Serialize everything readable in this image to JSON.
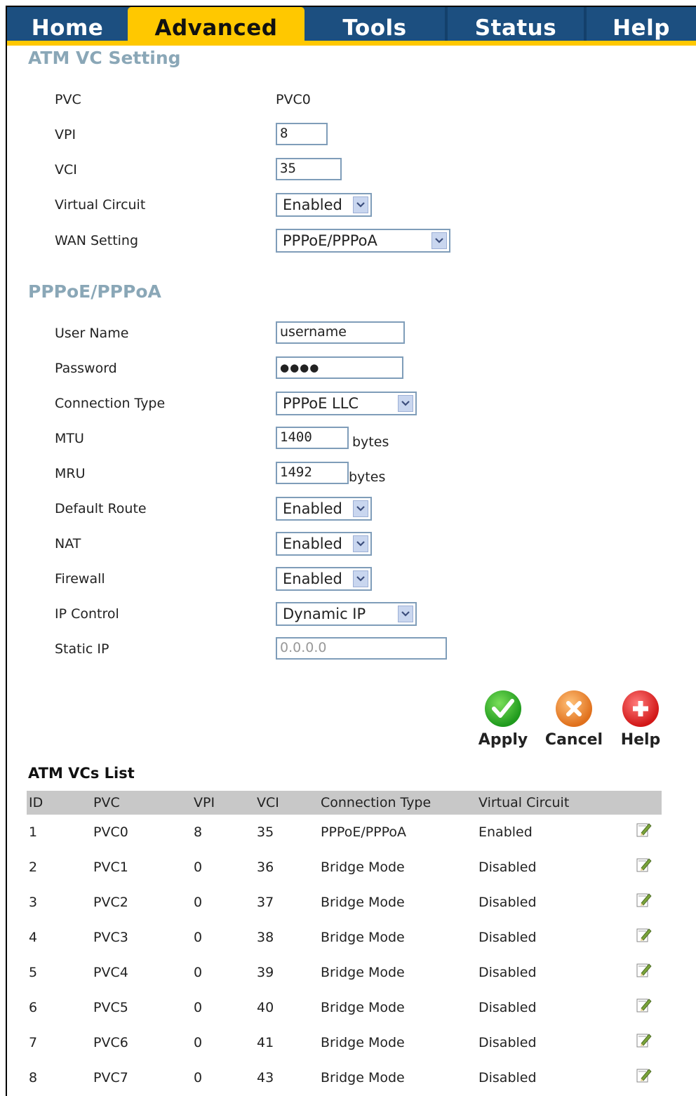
{
  "nav": {
    "tabs": [
      {
        "label": "Home"
      },
      {
        "label": "Advanced"
      },
      {
        "label": "Tools"
      },
      {
        "label": "Status"
      },
      {
        "label": "Help"
      }
    ],
    "active_tab": "Advanced"
  },
  "atm": {
    "title": "ATM VC Setting",
    "pvc_label": "PVC",
    "pvc_value": "PVC0",
    "vpi_label": "VPI",
    "vpi_value": "8",
    "vci_label": "VCI",
    "vci_value": "35",
    "vc_label": "Virtual Circuit",
    "vc_value": "Enabled",
    "wan_label": "WAN Setting",
    "wan_value": "PPPoE/PPPoA"
  },
  "pppoe": {
    "title": "PPPoE/PPPoA",
    "user_label": "User Name",
    "user_value": "username",
    "pass_label": "Password",
    "pass_value": "●●●●",
    "conn_label": "Connection Type",
    "conn_value": "PPPoE LLC",
    "mtu_label": "MTU",
    "mtu_value": "1400",
    "mtu_unit": "bytes",
    "mru_label": "MRU",
    "mru_value": "1492",
    "mru_unit": "bytes",
    "route_label": "Default Route",
    "route_value": "Enabled",
    "nat_label": "NAT",
    "nat_value": "Enabled",
    "fw_label": "Firewall",
    "fw_value": "Enabled",
    "ipc_label": "IP Control",
    "ipc_value": "Dynamic IP",
    "sip_label": "Static IP",
    "sip_value": "0.0.0.0"
  },
  "actions": {
    "apply": "Apply",
    "cancel": "Cancel",
    "help": "Help"
  },
  "list": {
    "title": "ATM VCs List",
    "headers": [
      "ID",
      "PVC",
      "VPI",
      "VCI",
      "Connection Type",
      "Virtual Circuit"
    ],
    "rows": [
      [
        "1",
        "PVC0",
        "8",
        "35",
        "PPPoE/PPPoA",
        "Enabled"
      ],
      [
        "2",
        "PVC1",
        "0",
        "36",
        "Bridge Mode",
        "Disabled"
      ],
      [
        "3",
        "PVC2",
        "0",
        "37",
        "Bridge Mode",
        "Disabled"
      ],
      [
        "4",
        "PVC3",
        "0",
        "38",
        "Bridge Mode",
        "Disabled"
      ],
      [
        "5",
        "PVC4",
        "0",
        "39",
        "Bridge Mode",
        "Disabled"
      ],
      [
        "6",
        "PVC5",
        "0",
        "40",
        "Bridge Mode",
        "Disabled"
      ],
      [
        "7",
        "PVC6",
        "0",
        "41",
        "Bridge Mode",
        "Disabled"
      ],
      [
        "8",
        "PVC7",
        "0",
        "43",
        "Bridge Mode",
        "Disabled"
      ]
    ]
  },
  "colors": {
    "tab_blue": "#1c4f80",
    "tab_active": "#ffc800",
    "section_title": "#8aa7b7"
  }
}
